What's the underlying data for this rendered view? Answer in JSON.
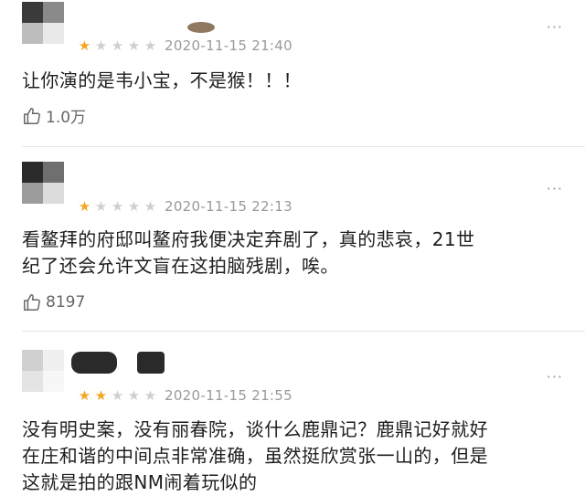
{
  "reviews": [
    {
      "rating": 1,
      "date": "2020-11-15 21:40",
      "content_lines": [
        "让你演的是韦小宝，不是猴！！！"
      ],
      "likes": "1.0万",
      "more": "···"
    },
    {
      "rating": 1,
      "date": "2020-11-15 22:13",
      "content_lines": [
        "看鳌拜的府邸叫鳌府我便决定弃剧了，真的悲哀，21世",
        "纪了还会允许文盲在这拍脑残剧，唉。"
      ],
      "likes": "8197",
      "more": "···"
    },
    {
      "rating": 2,
      "date": "2020-11-15 21:55",
      "content_lines": [
        "没有明史案，没有丽春院，谈什么鹿鼎记？鹿鼎记好就好",
        "在庄和谐的中间点非常准确，虽然挺欣赏张一山的，但是",
        "这就是拍的跟NM闹着玩似的"
      ],
      "likes": "",
      "more": "···"
    }
  ],
  "star_glyph": "★",
  "icons": {
    "like": "thumbs-up-icon",
    "more": "more-dots-icon"
  },
  "colors": {
    "star_on": "#f5a623",
    "star_off": "#cfcfcf",
    "meta": "#9a9a9a"
  }
}
